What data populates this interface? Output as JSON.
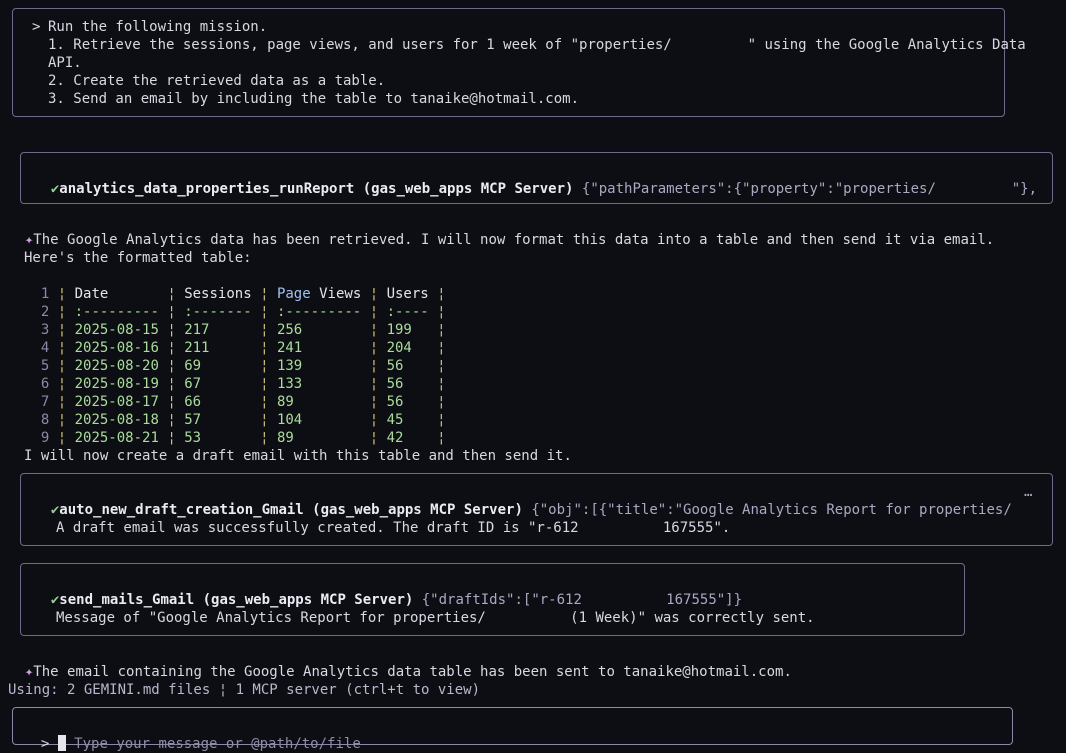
{
  "prompt": {
    "marker": ">",
    "lines": [
      "Run the following mission.",
      "1. Retrieve the sessions, page views, and users for 1 week of \"properties/         \" using the Google Analytics Data",
      "API.",
      "2. Create the retrieved data as a table.",
      "3. Send an email by including the table to tanaike@hotmail.com."
    ]
  },
  "tool1": {
    "check": "✔",
    "name": "analytics_data_properties_runReport (gas_web_apps MCP Server)",
    "args": "{\"pathParameters\":{\"property\":\"properties/         \"},\"reque…"
  },
  "msg1": {
    "spark": "✦",
    "text": "The Google Analytics data has been retrieved. I will now format this data into a table and then send it via email."
  },
  "msg2": "Here's the formatted table:",
  "table": {
    "headers": [
      "Date",
      "Sessions",
      "Page Views",
      "Users"
    ],
    "header_highlight": "Page",
    "separators": [
      ":---------",
      ":-------",
      ":---------",
      ":----"
    ],
    "rows": [
      [
        "2025-08-15",
        "217",
        "256",
        "199"
      ],
      [
        "2025-08-16",
        "211",
        "241",
        "204"
      ],
      [
        "2025-08-20",
        "69",
        "139",
        "56"
      ],
      [
        "2025-08-19",
        "67",
        "133",
        "56"
      ],
      [
        "2025-08-17",
        "66",
        "89",
        "56"
      ],
      [
        "2025-08-18",
        "57",
        "104",
        "45"
      ],
      [
        "2025-08-21",
        "53",
        "89",
        "42"
      ]
    ]
  },
  "msg3": "I will now create a draft email with this table and then send it.",
  "tool2": {
    "check": "✔",
    "name": "auto_new_draft_creation_Gmail (gas_web_apps MCP Server)",
    "args": "{\"obj\":[{\"title\":\"Google Analytics Report for properties/",
    "ellipsis": "…",
    "result": "A draft email was successfully created. The draft ID is \"r-612          167555\"."
  },
  "tool3": {
    "check": "✔",
    "name": "send_mails_Gmail (gas_web_apps MCP Server)",
    "args": "{\"draftIds\":[\"r-612          167555\"]}",
    "result": "Message of \"Google Analytics Report for properties/          (1 Week)\" was correctly sent."
  },
  "msg4": {
    "spark": "✦",
    "text": "The email containing the Google Analytics data table has been sent to tanaike@hotmail.com."
  },
  "status": "Using: 2 GEMINI.md files ¦ 1 MCP server (ctrl+t to view)",
  "input": {
    "marker": ">",
    "placeholder": "Type your message or @path/to/file"
  }
}
